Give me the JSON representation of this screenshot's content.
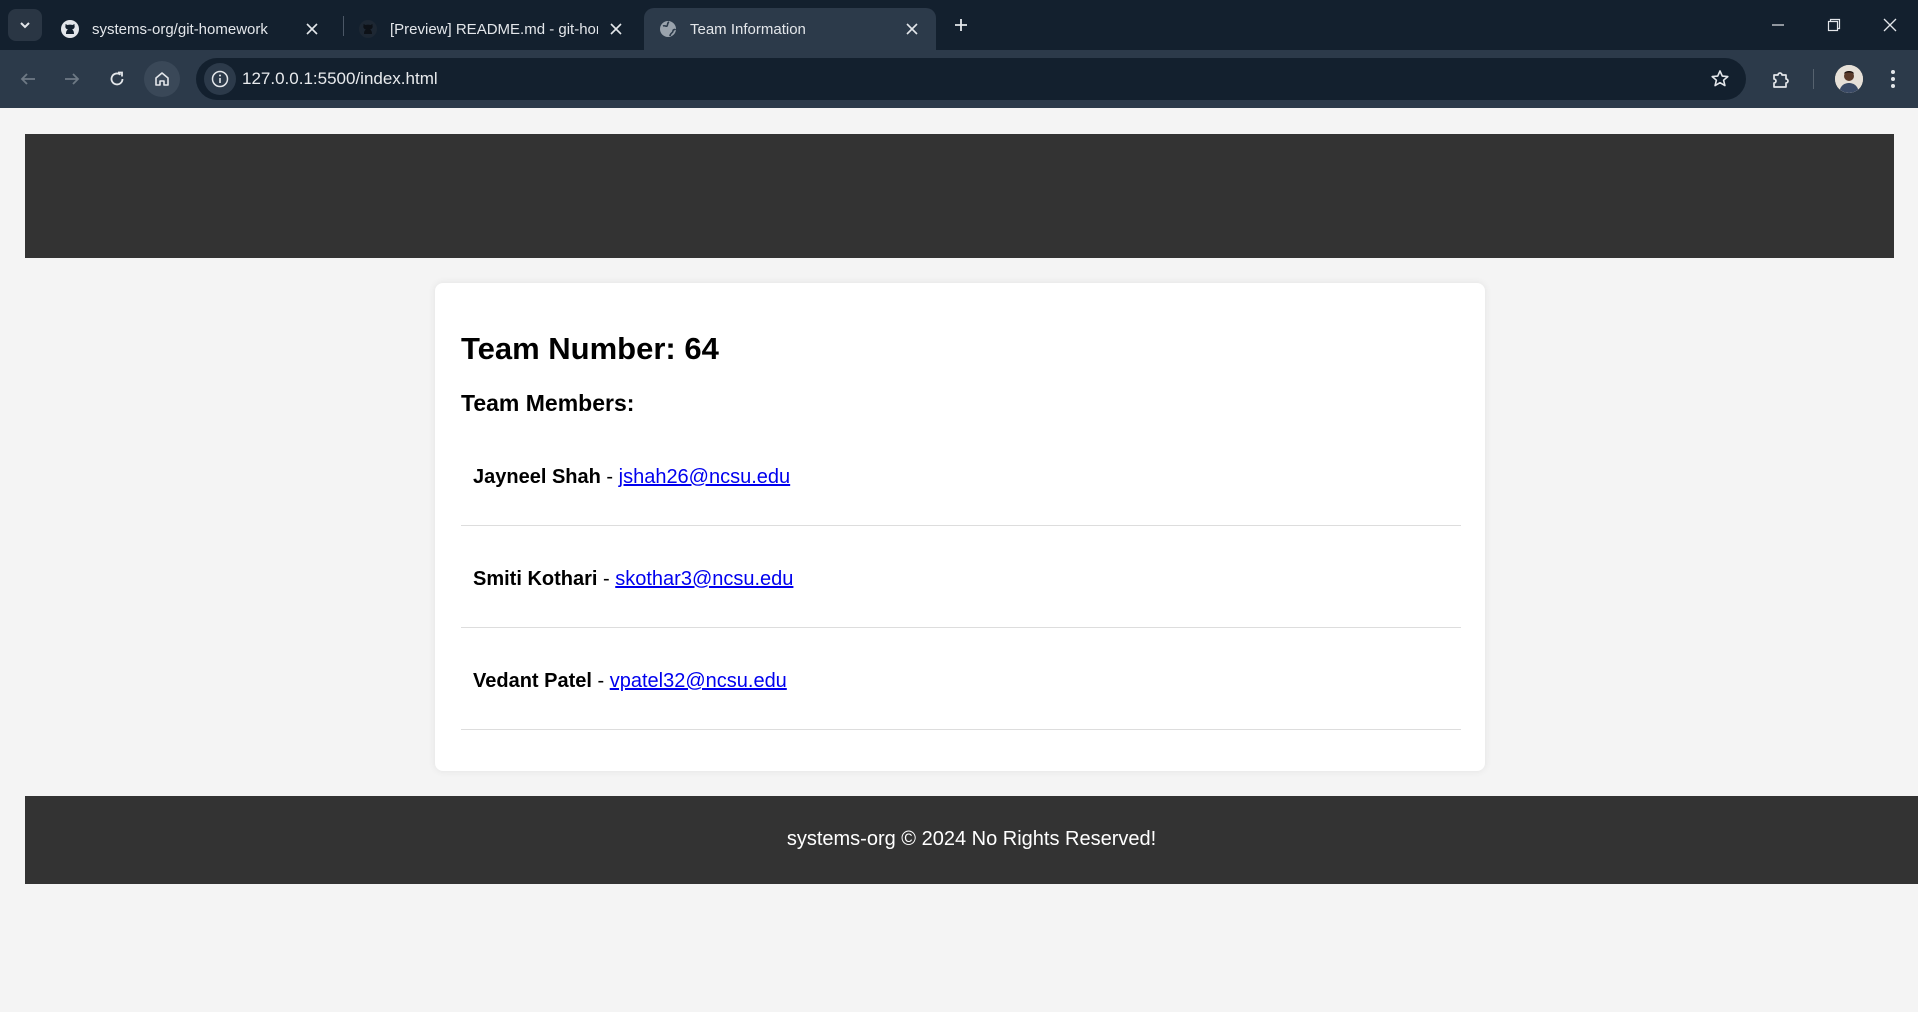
{
  "browser": {
    "tabs": [
      {
        "title": "systems-org/git-homework",
        "icon": "github-icon",
        "active": false
      },
      {
        "title": "[Preview] README.md - git-hon",
        "icon": "github-icon",
        "active": false
      },
      {
        "title": "Team Information",
        "icon": "globe-icon",
        "active": true
      }
    ],
    "url": "127.0.0.1:5500/index.html"
  },
  "page": {
    "team_number": "Team Number: 64",
    "members_heading": "Team Members:",
    "members": [
      {
        "name": "Jayneel Shah",
        "separator": " - ",
        "email": "jshah26@ncsu.edu"
      },
      {
        "name": "Smiti Kothari",
        "separator": " - ",
        "email": "skothar3@ncsu.edu"
      },
      {
        "name": "Vedant Patel",
        "separator": " - ",
        "email": "vpatel32@ncsu.edu"
      }
    ],
    "footer": "systems-org © 2024 No Rights Reserved!"
  },
  "colors": {
    "header_bg": "#333333",
    "page_bg": "#f4f4f4",
    "link": "#0000ee",
    "chrome_dark": "#13202e",
    "chrome_light": "#2c3a4a"
  }
}
